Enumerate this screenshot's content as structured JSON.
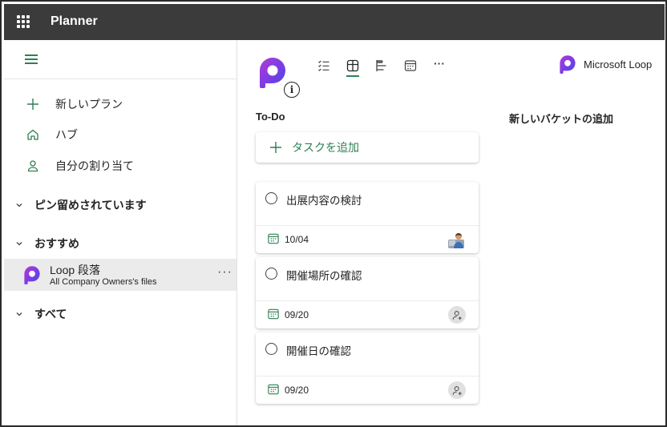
{
  "app": {
    "title": "Planner"
  },
  "sidebar": {
    "nav": [
      {
        "label": "新しいプラン",
        "icon": "plus-icon"
      },
      {
        "label": "ハブ",
        "icon": "home-icon"
      },
      {
        "label": "自分の割り当て",
        "icon": "person-icon"
      }
    ],
    "sections": [
      {
        "label": "ピン留めされています"
      },
      {
        "label": "おすすめ"
      },
      {
        "label": "すべて"
      }
    ],
    "recommended_plan": {
      "name": "Loop 段落",
      "subtitle": "All Company Owners's files",
      "more": "···"
    }
  },
  "header": {
    "view_tabs": [
      "list-view-icon",
      "board-view-icon",
      "timeline-view-icon",
      "schedule-view-icon"
    ],
    "more": "···",
    "loop_link": "Microsoft Loop",
    "info": "i"
  },
  "board": {
    "buckets": [
      {
        "title": "To-Do",
        "add_task_label": "タスクを追加",
        "tasks": [
          {
            "title": "出展内容の検討",
            "due": "10/04",
            "assignee": "photo"
          },
          {
            "title": "開催場所の確認",
            "due": "09/20",
            "assignee": "unassigned"
          },
          {
            "title": "開催日の確認",
            "due": "09/20",
            "assignee": "unassigned"
          }
        ]
      }
    ],
    "new_bucket_label": "新しいバケットの追加"
  },
  "colors": {
    "accent": "#2f7f55",
    "topbar": "#3b3b3b",
    "selected_row": "#ebebeb"
  }
}
